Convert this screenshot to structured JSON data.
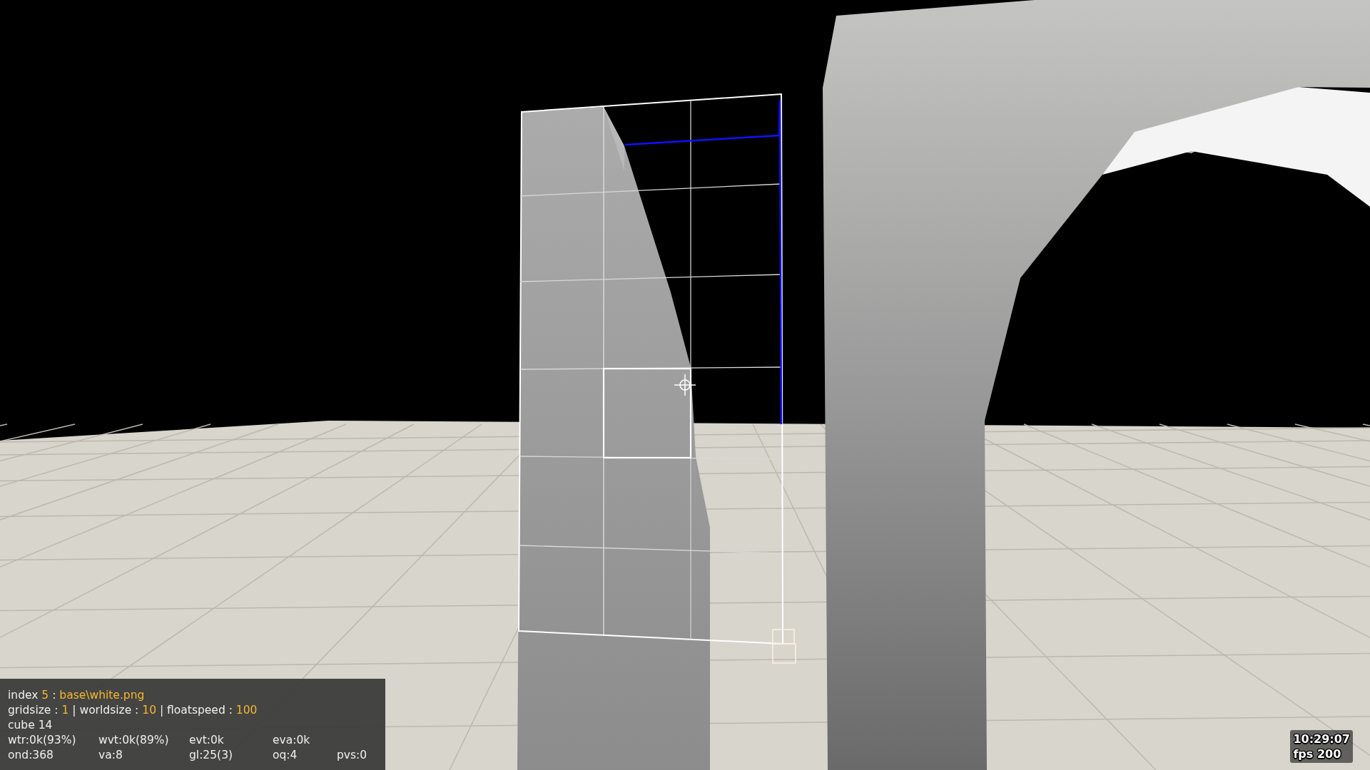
{
  "hud": {
    "lines": [
      [
        {
          "text": "index ",
          "kind": "plain"
        },
        {
          "text": "5",
          "kind": "value"
        },
        {
          "text": " : ",
          "kind": "plain"
        },
        {
          "text": "base\\white.png",
          "kind": "value"
        }
      ],
      [
        {
          "text": "gridsize : ",
          "kind": "plain"
        },
        {
          "text": "1",
          "kind": "value"
        },
        {
          "text": " | worldsize : ",
          "kind": "plain"
        },
        {
          "text": "10",
          "kind": "value"
        },
        {
          "text": " | floatspeed : ",
          "kind": "plain"
        },
        {
          "text": "100",
          "kind": "value"
        }
      ],
      [
        {
          "text": "cube 14",
          "kind": "plain"
        }
      ]
    ],
    "stats": [
      [
        "wtr:0k(93%)",
        "wvt:0k(89%)",
        "evt:0k",
        "eva:0k"
      ],
      [
        "ond:368",
        "va:8",
        "gl:25(3)",
        "oq:4",
        "pvs:0"
      ]
    ]
  },
  "clock": "10:29:07",
  "fps": "fps 200"
}
